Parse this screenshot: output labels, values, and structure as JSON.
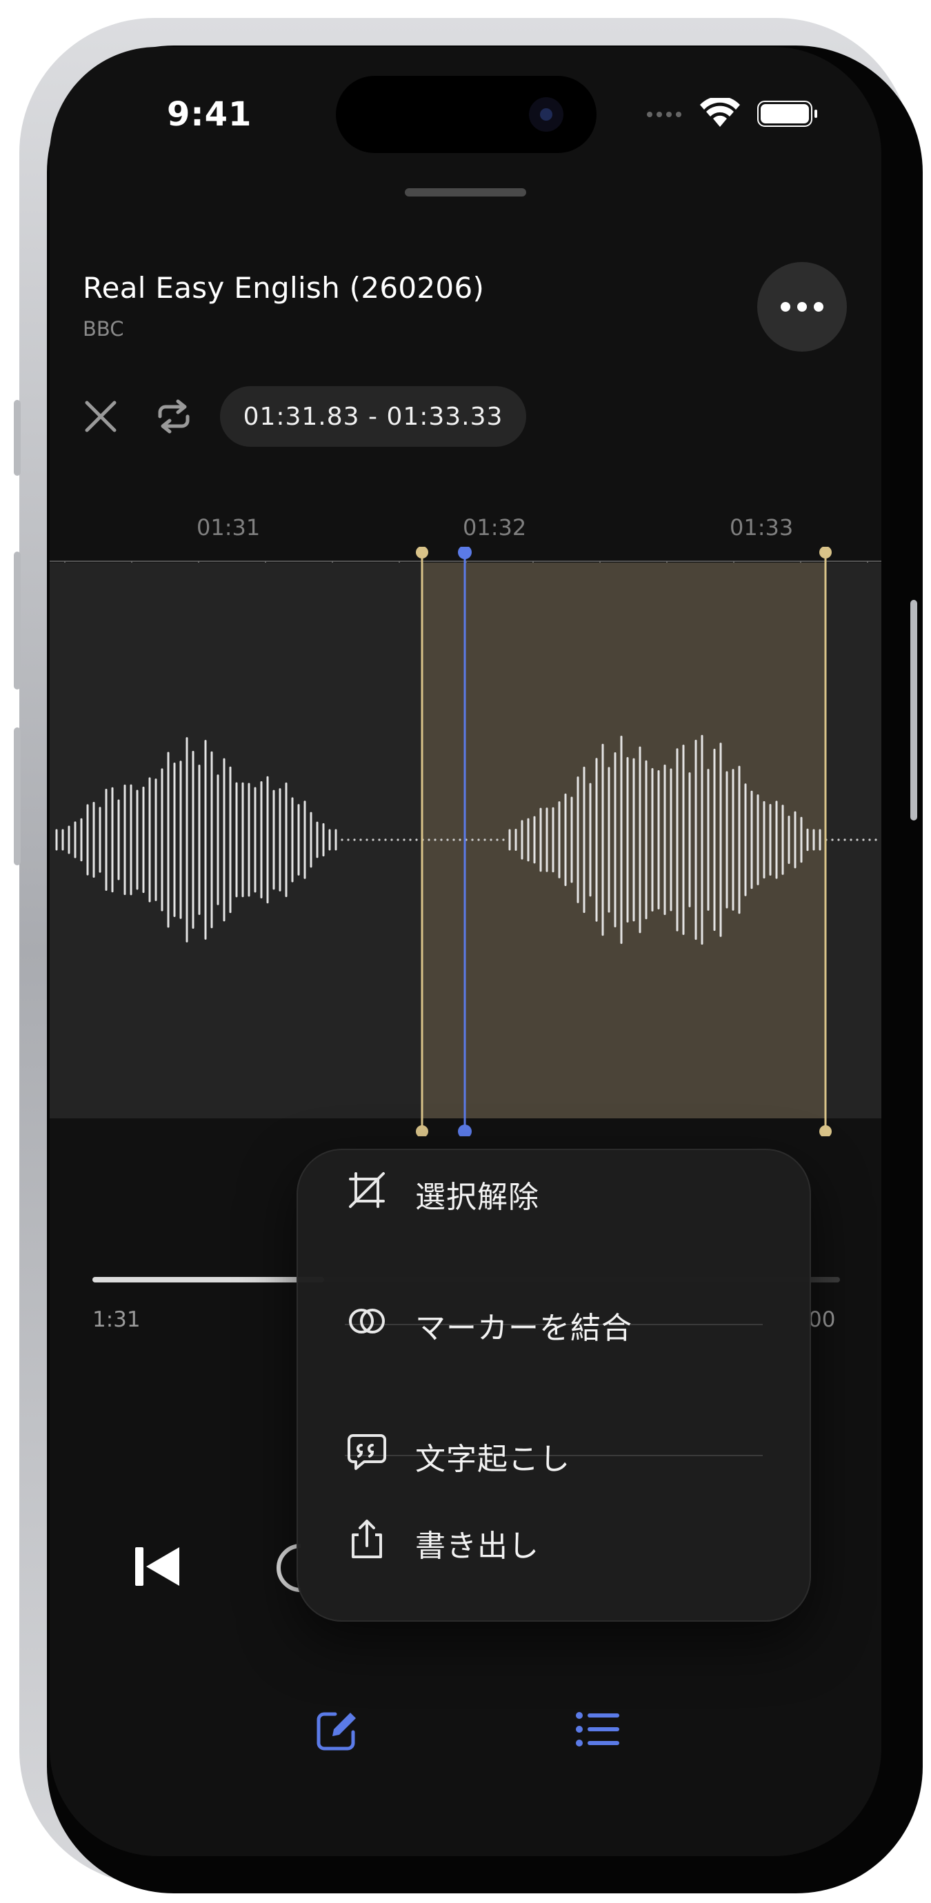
{
  "status_bar": {
    "time": "9:41"
  },
  "header": {
    "title": "Real Easy English (260206)",
    "subtitle": "BBC"
  },
  "toolbar": {
    "range_label": "01:31.83 - 01:33.33"
  },
  "timeline": {
    "tick_labels": [
      "01:31",
      "01:32",
      "01:33"
    ]
  },
  "playback": {
    "start_label": "1:31",
    "end_label": "00",
    "progress": 0.31
  },
  "context_menu": {
    "items": [
      {
        "label": "選択解除",
        "icon": "deselect-icon"
      },
      {
        "label": "マーカーを結合",
        "icon": "merge-markers-icon"
      },
      {
        "label": "文字起こし",
        "icon": "transcribe-icon"
      },
      {
        "label": "書き出し",
        "icon": "export-icon"
      }
    ]
  },
  "colors": {
    "accent": "#5b7be8",
    "selection_marker": "#d9c389",
    "selection_fill": "#4b4438",
    "background": "#111111"
  }
}
